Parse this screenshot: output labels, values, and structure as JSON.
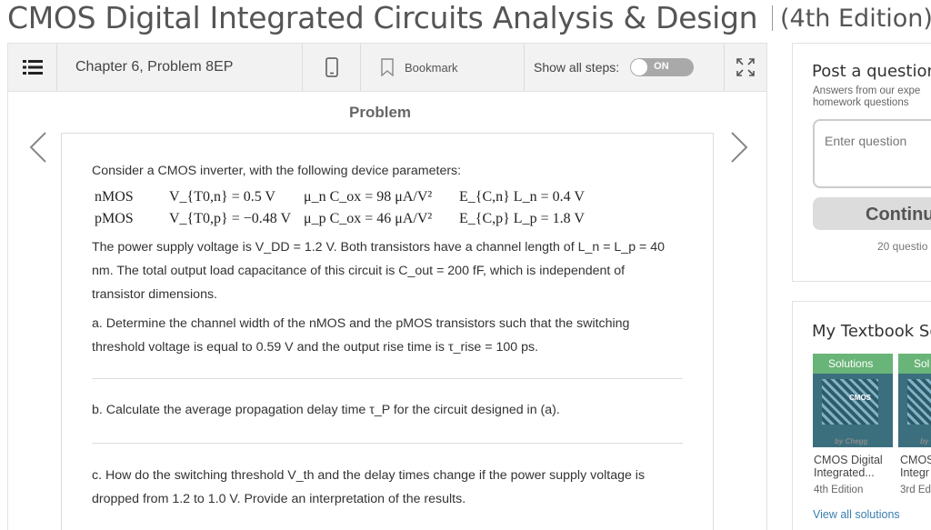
{
  "book": {
    "title": "CMOS Digital Integrated Circuits Analysis & Design",
    "edition": "(4th Edition)"
  },
  "toolbar": {
    "chapter_label": "Chapter 6, Problem 8EP",
    "bookmark_label": "Bookmark",
    "show_steps_label": "Show all steps:",
    "toggle_label": "ON"
  },
  "problem": {
    "heading": "Problem",
    "intro": "Consider a CMOS inverter, with the following device parameters:",
    "params": {
      "nmos_label": "nMOS",
      "pmos_label": "pMOS",
      "nmos_vt": "V_{T0,n} = 0.5 V",
      "pmos_vt": "V_{T0,p} = −0.48 V",
      "nmos_cox": "μ_n C_ox = 98 μA/V²",
      "pmos_cox": "μ_p C_ox = 46 μA/V²",
      "nmos_ecl": "E_{C,n} L_n = 0.4 V",
      "pmos_ecl": "E_{C,p} L_p = 1.8 V"
    },
    "supply_line1": "The power supply voltage is V_DD = 1.2 V. Both transistors have a channel length of L_n = L_p = 40",
    "supply_line2": "nm. The total output load capacitance of this circuit is C_out = 200 fF, which is independent of",
    "supply_line3": "transistor dimensions.",
    "part_a_line1": "a. Determine the channel width of the nMOS and the pMOS transistors such that the switching",
    "part_a_line2": "threshold voltage is equal to 0.59 V and the output rise time is τ_rise = 100 ps.",
    "part_b": "b. Calculate the average propagation delay time τ_P for the circuit designed in (a).",
    "part_c_line1": "c. How do the switching threshold V_th and the delay times change if the power supply voltage is",
    "part_c_line2": "dropped from 1.2 to 1.0 V. Provide an interpretation of the results."
  },
  "sidebar": {
    "post_title": "Post a question",
    "post_sub1": "Answers from our expe",
    "post_sub2": "homework questions",
    "question_placeholder": "Enter question",
    "continue_label": "Continu",
    "question_count": "20 questio",
    "textbook_title": "My Textbook So",
    "books": [
      {
        "tab": "Solutions",
        "brand": "by Chegg",
        "cover_label": "CMOS",
        "name1": "CMOS Digital",
        "name2": "Integrated...",
        "edition": "4th Edition"
      },
      {
        "tab": "Sol",
        "brand": "by",
        "name1": "CMOS",
        "name2": "Integr",
        "edition": "3rd Ed"
      }
    ],
    "view_all": "View all solutions"
  },
  "colors": {
    "accent_green": "#69b478",
    "toggle_gray": "#a9a9a9",
    "link_blue": "#3a7fb0"
  }
}
